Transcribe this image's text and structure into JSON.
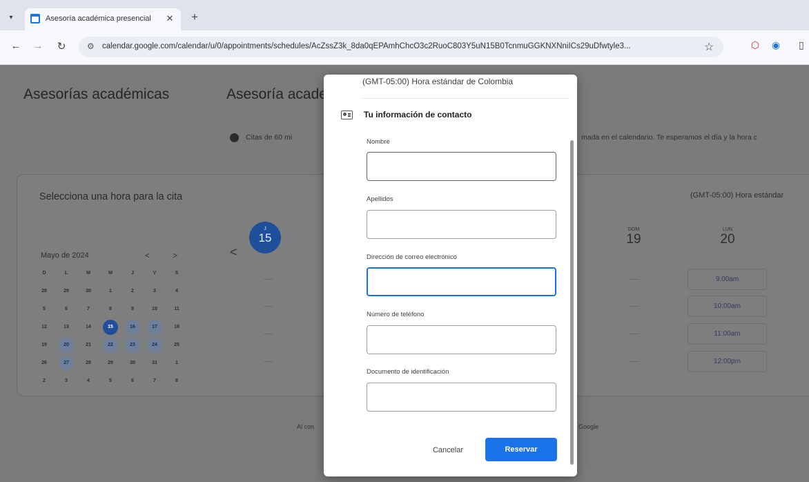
{
  "browser": {
    "tab_title": "Asesoría académica presencial",
    "tab_close": "✕",
    "new_tab": "+",
    "url": "calendar.google.com/calendar/u/0/appointments/schedules/AcZssZ3k_8da0qEPAmhChcO3c2RuoC803Y5uN15B0TcnmuGGKNXNniICs29uDfwtyle3...",
    "nav_icons": [
      "back-icon",
      "forward-icon",
      "reload-icon"
    ]
  },
  "page": {
    "title": "Asesorías académicas",
    "event_title": "Asesoría acade",
    "description_left": "Citas de 60 mi",
    "description_right": "mada en el calendario. Te esperamos el día y la hora c",
    "select_title": "Selecciona una hora para la cita",
    "timezone_short": "(GMT-05:00) Hora estándar",
    "month_label": "Mayo de 2024",
    "month_prev": "<",
    "month_next": ">",
    "week_prev": "<",
    "selected_day": {
      "dow": "J",
      "num": "15"
    },
    "day_sun": {
      "dow": "DOM",
      "num": "19"
    },
    "day_mon": {
      "dow": "LUN",
      "num": "20"
    },
    "slots": [
      "9:00am",
      "10:00am",
      "11:00am",
      "12:00pm"
    ],
    "footer_left": "Al con",
    "footer_right": "Google"
  },
  "calendar": {
    "rows": [
      [
        {
          "t": "D"
        },
        {
          "t": "L"
        },
        {
          "t": "M"
        },
        {
          "t": "M"
        },
        {
          "t": "J"
        },
        {
          "t": "V"
        },
        {
          "t": "S"
        }
      ],
      [
        {
          "t": "28"
        },
        {
          "t": "29"
        },
        {
          "t": "30"
        },
        {
          "t": "1"
        },
        {
          "t": "2"
        },
        {
          "t": "3"
        },
        {
          "t": "4"
        }
      ],
      [
        {
          "t": "5"
        },
        {
          "t": "6"
        },
        {
          "t": "7"
        },
        {
          "t": "8"
        },
        {
          "t": "9"
        },
        {
          "t": "10"
        },
        {
          "t": "11"
        }
      ],
      [
        {
          "t": "12"
        },
        {
          "t": "13"
        },
        {
          "t": "14"
        },
        {
          "t": "15",
          "s": "sel"
        },
        {
          "t": "16",
          "s": "avail"
        },
        {
          "t": "17",
          "s": "avail"
        },
        {
          "t": "18"
        }
      ],
      [
        {
          "t": "19"
        },
        {
          "t": "20",
          "s": "avail"
        },
        {
          "t": "21"
        },
        {
          "t": "22",
          "s": "avail"
        },
        {
          "t": "23",
          "s": "avail"
        },
        {
          "t": "24",
          "s": "avail"
        },
        {
          "t": "25"
        }
      ],
      [
        {
          "t": "26"
        },
        {
          "t": "27",
          "s": "avail"
        },
        {
          "t": "28"
        },
        {
          "t": "29"
        },
        {
          "t": "30"
        },
        {
          "t": "31"
        },
        {
          "t": "1"
        }
      ],
      [
        {
          "t": "2"
        },
        {
          "t": "3"
        },
        {
          "t": "4"
        },
        {
          "t": "5"
        },
        {
          "t": "6"
        },
        {
          "t": "7"
        },
        {
          "t": "8"
        }
      ]
    ]
  },
  "modal": {
    "timezone": "(GMT-05:00) Hora estándar de Colombia",
    "contact_heading": "Tu información de contacto",
    "fields": [
      {
        "label": "Nombre",
        "value": ""
      },
      {
        "label": "Apellidos",
        "value": ""
      },
      {
        "label": "Dirección de correo electrónico",
        "value": ""
      },
      {
        "label": "Número de teléfono",
        "value": ""
      },
      {
        "label": "Documento de identificación",
        "value": ""
      }
    ],
    "cancel_label": "Cancelar",
    "reserve_label": "Reservar"
  },
  "colors": {
    "accent": "#1a73e8",
    "overlay": "#7b7b7b",
    "selected_day": "#1f4f9a"
  }
}
